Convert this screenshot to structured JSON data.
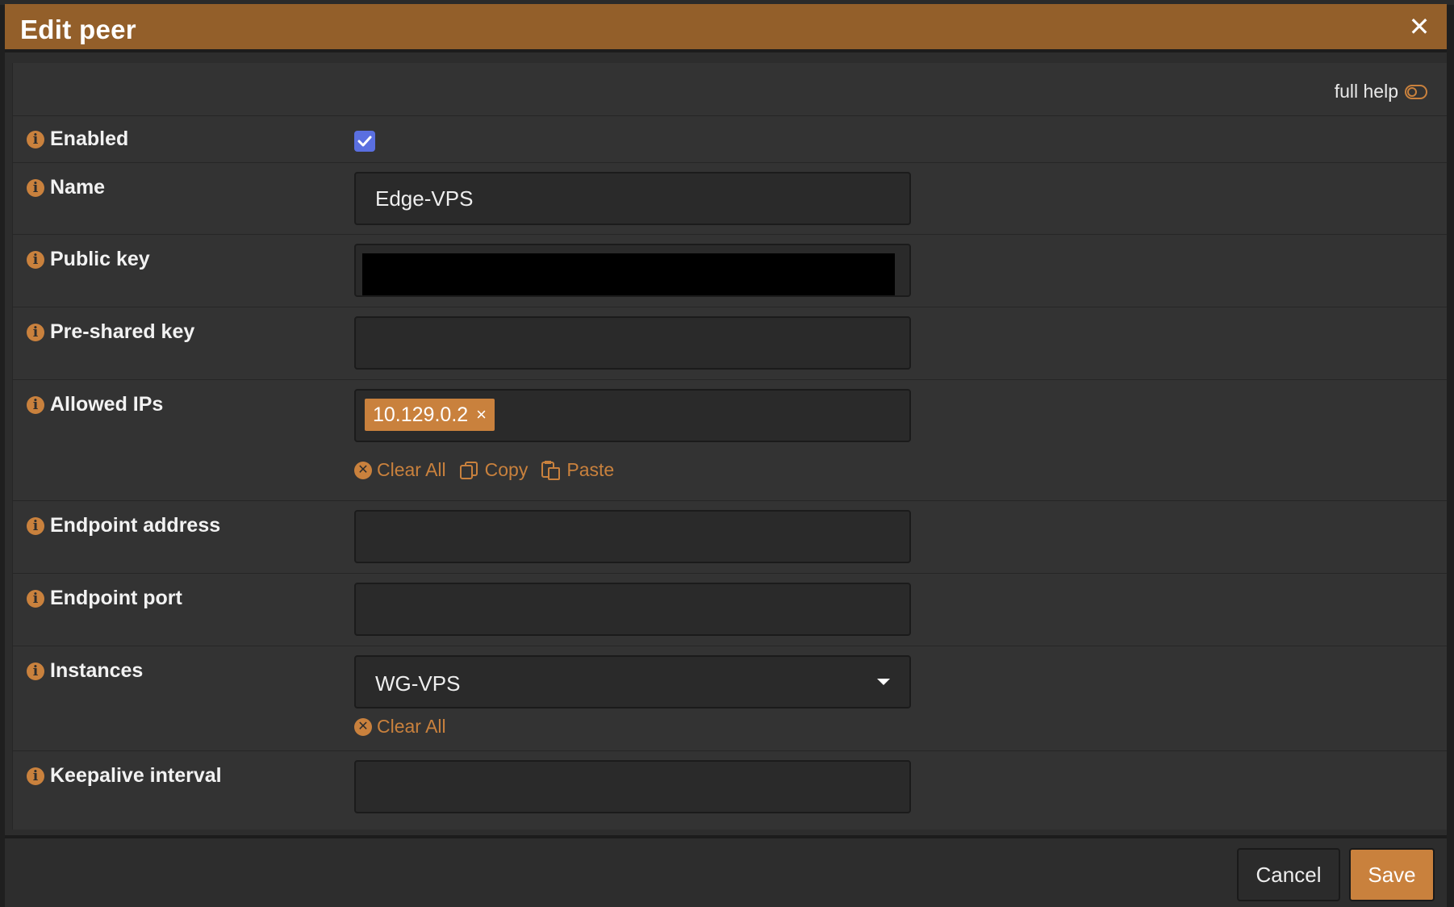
{
  "dialog": {
    "title": "Edit peer",
    "close_symbol": "✕"
  },
  "help_toggle": {
    "label": "full help",
    "icon": "toggle-off-icon"
  },
  "fields": {
    "enabled": {
      "label": "Enabled",
      "checked": true
    },
    "name": {
      "label": "Name",
      "value": "Edge-VPS"
    },
    "public_key": {
      "label": "Public key",
      "value": ""
    },
    "pre_shared_key": {
      "label": "Pre-shared key",
      "value": ""
    },
    "allowed_ips": {
      "label": "Allowed IPs",
      "tags": [
        "10.129.0.2"
      ],
      "remove_symbol": "×",
      "actions": {
        "clear_all": "Clear All",
        "copy": "Copy",
        "paste": "Paste"
      }
    },
    "endpoint_address": {
      "label": "Endpoint address",
      "value": ""
    },
    "endpoint_port": {
      "label": "Endpoint port",
      "value": ""
    },
    "instances": {
      "label": "Instances",
      "selected": "WG-VPS",
      "actions": {
        "clear_all": "Clear All"
      }
    },
    "keepalive_interval": {
      "label": "Keepalive interval",
      "value": ""
    }
  },
  "footer": {
    "cancel_label": "Cancel",
    "save_label": "Save"
  },
  "colors": {
    "header": "#935f2a",
    "accent": "#c9813d",
    "checkbox": "#5a6fe0"
  }
}
